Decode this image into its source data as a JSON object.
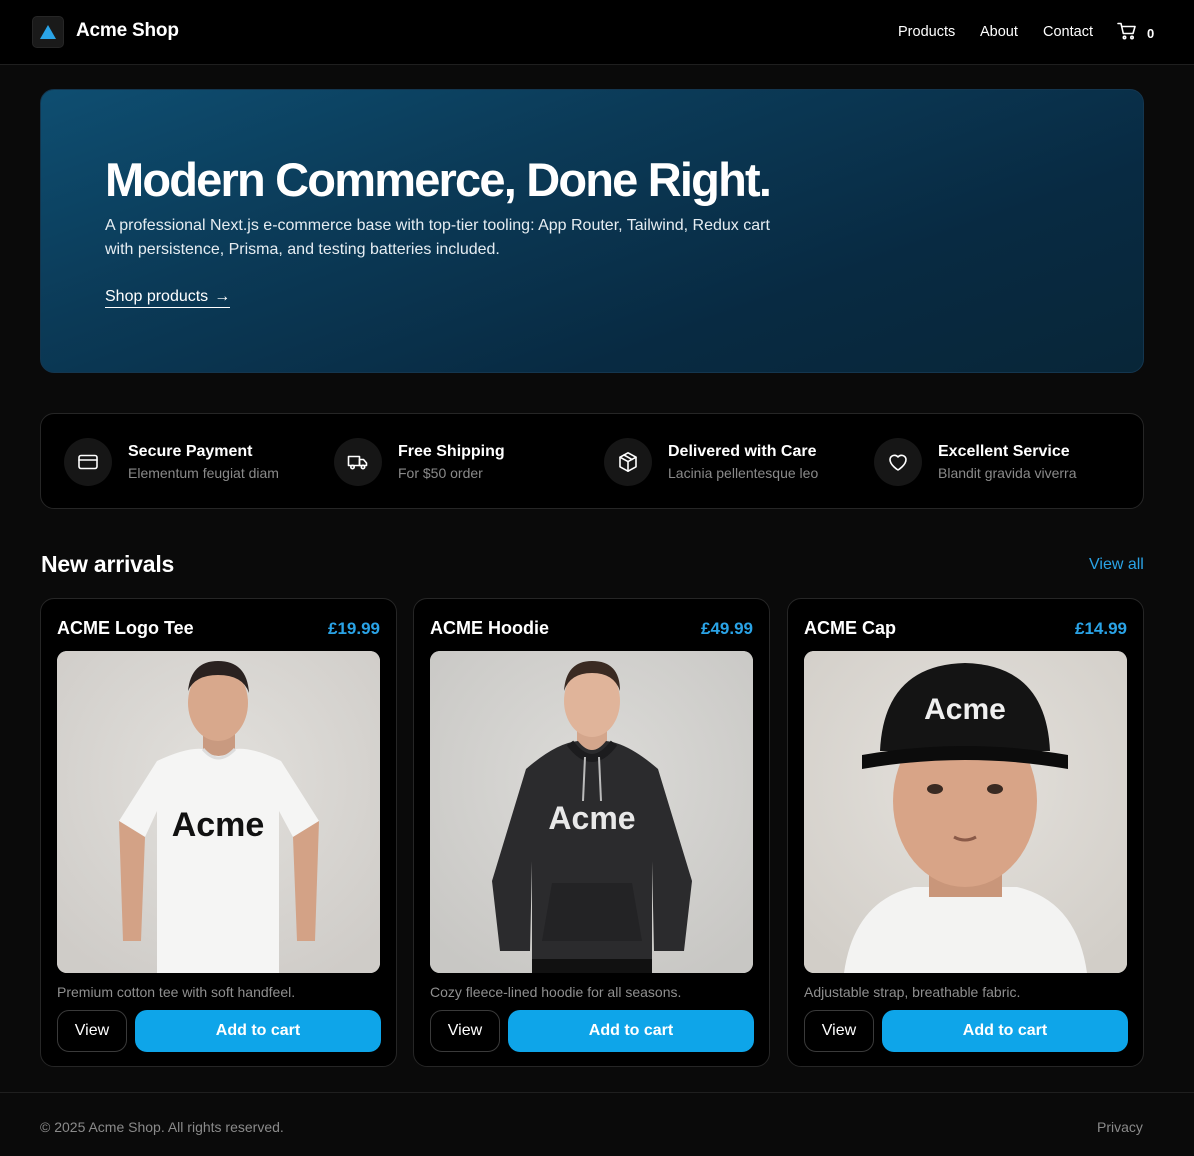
{
  "header": {
    "brand": "Acme Shop",
    "nav": [
      "Products",
      "About",
      "Contact"
    ],
    "cart_count": "0"
  },
  "hero": {
    "title": "Modern Commerce, Done Right.",
    "text": "A professional Next.js e-commerce base with top-tier tooling: App Router, Tailwind, Redux cart with persistence, Prisma, and testing batteries included.",
    "link_label": "Shop products",
    "link_arrow": "→"
  },
  "features": [
    {
      "icon": "credit-card-icon",
      "title": "Secure Payment",
      "subtitle": "Elementum feugiat diam"
    },
    {
      "icon": "truck-icon",
      "title": "Free Shipping",
      "subtitle": "For $50 order"
    },
    {
      "icon": "package-icon",
      "title": "Delivered with Care",
      "subtitle": "Lacinia pellentesque leo"
    },
    {
      "icon": "heart-icon",
      "title": "Excellent Service",
      "subtitle": "Blandit gravida viverra"
    }
  ],
  "new_arrivals": {
    "title": "New arrivals",
    "view_all": "View all",
    "products": [
      {
        "name": "ACME Logo Tee",
        "price": "£19.99",
        "description": "Premium cotton tee with soft handfeel.",
        "image_text": "Acme",
        "view_label": "View",
        "add_label": "Add to cart"
      },
      {
        "name": "ACME Hoodie",
        "price": "£49.99",
        "description": "Cozy fleece-lined hoodie for all seasons.",
        "image_text": "Acme",
        "view_label": "View",
        "add_label": "Add to cart"
      },
      {
        "name": "ACME Cap",
        "price": "£14.99",
        "description": "Adjustable strap, breathable fabric.",
        "image_text": "Acme",
        "view_label": "View",
        "add_label": "Add to cart"
      }
    ]
  },
  "footer": {
    "copyright": "© 2025 Acme Shop. All rights reserved.",
    "privacy": "Privacy"
  },
  "colors": {
    "accent": "#0ea5e9",
    "price": "#2aa3e6",
    "background": "#0a0a0a"
  }
}
